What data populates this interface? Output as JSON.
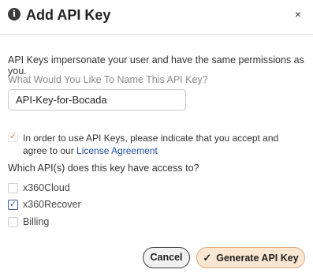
{
  "dialog": {
    "title": "Add API Key",
    "close_glyph": "×",
    "info_glyph": "i"
  },
  "description": "API Keys impersonate your user and have the same permissions as you.",
  "name_field": {
    "label": "What Would You Like To Name This API Key?",
    "value": "API-Key-for-Bocada"
  },
  "agreement": {
    "checked": true,
    "text": "In order to use API Keys, please indicate that you accept and agree to our ",
    "link_text": "License Agreement",
    "check_glyph": "✓"
  },
  "access": {
    "label": "Which API(s) does this key have access to?",
    "options": [
      {
        "label": "x360Cloud",
        "checked": false
      },
      {
        "label": "x360Recover",
        "checked": true,
        "glyph": "✓"
      },
      {
        "label": "Billing",
        "checked": false
      }
    ]
  },
  "buttons": {
    "cancel": "Cancel",
    "generate": "Generate API Key",
    "generate_glyph": "✓"
  },
  "colors": {
    "accent_orange": "#e07a2e",
    "check_blue": "#3b5aa8",
    "link_blue": "#1f4fa3",
    "generate_bg": "#fbe6d2"
  }
}
